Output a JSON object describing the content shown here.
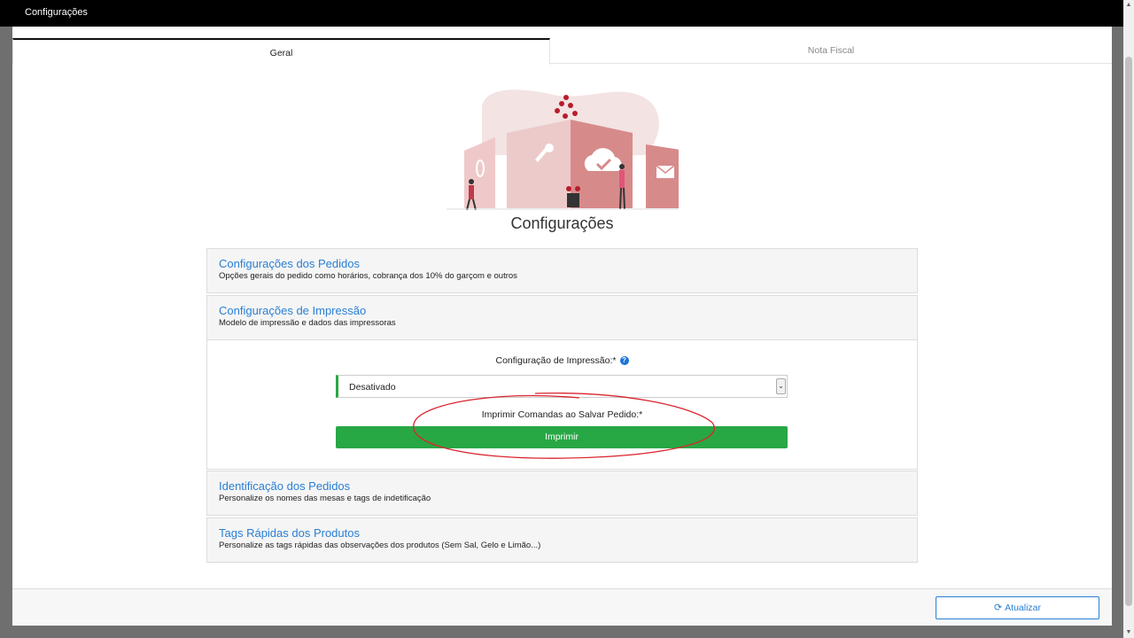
{
  "window": {
    "title": "Configurações"
  },
  "tabs": [
    {
      "label": "Geral",
      "active": true
    },
    {
      "label": "Nota Fiscal",
      "active": false
    }
  ],
  "page": {
    "title": "Configurações"
  },
  "sections": [
    {
      "title": "Configurações dos Pedidos",
      "description": "Opções gerais do pedido como horários, cobrança dos 10% do garçom e outros"
    },
    {
      "title": "Configurações de Impressão",
      "description": "Modelo de impressão e dados das impressoras"
    },
    {
      "title": "Identificação dos Pedidos",
      "description": "Personalize os nomes das mesas e tags de indetificação"
    },
    {
      "title": "Tags Rápidas dos Produtos",
      "description": "Personalize as tags rápidas das observações dos produtos (Sem Sal, Gelo e Limão...)"
    }
  ],
  "print_settings": {
    "config_label": "Configuração de Impressão:*",
    "config_value": "Desativado",
    "print_on_save_label": "Imprimir Comandas ao Salvar Pedido:*",
    "print_button": "Imprimir"
  },
  "footer": {
    "refresh_button": "Atualizar"
  },
  "colors": {
    "accent": "#2a7fd4",
    "success": "#28a745",
    "annotation": "#d9252f"
  }
}
